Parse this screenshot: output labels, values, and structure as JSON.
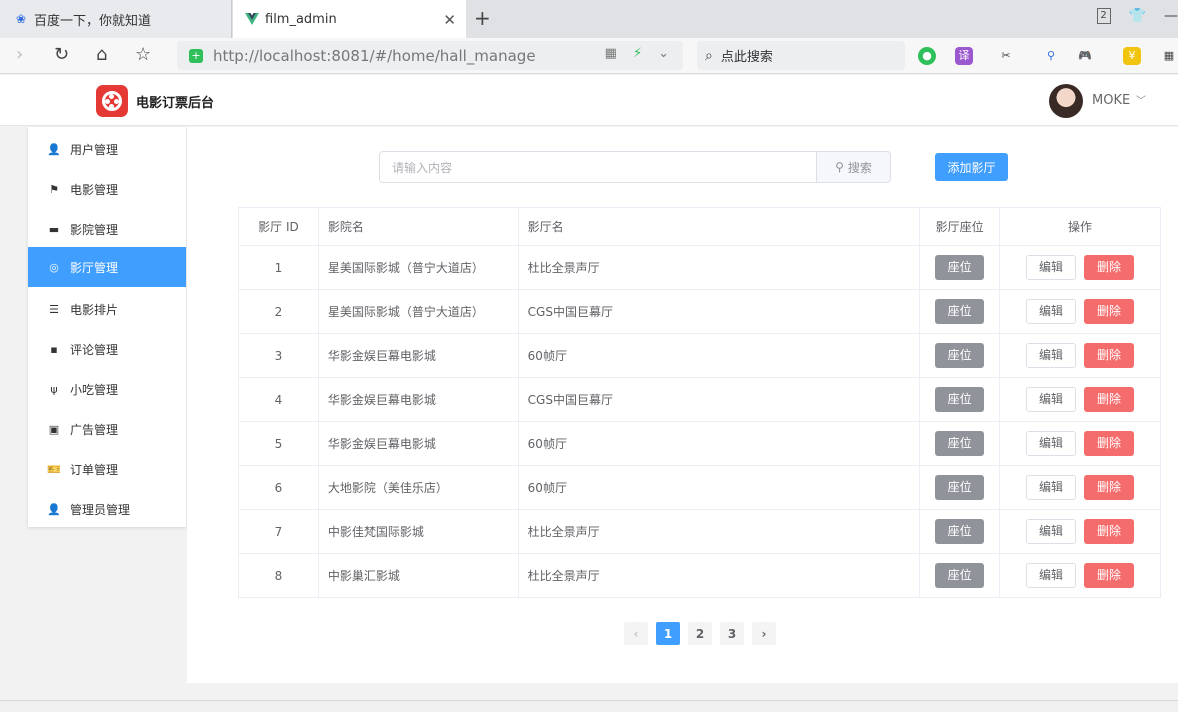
{
  "browser": {
    "tabs": [
      {
        "title": "百度一下，你就知道",
        "icon": "baidu-paw-icon"
      },
      {
        "title": "film_admin",
        "icon": "vue-logo-icon"
      }
    ],
    "url": "http://localhost:8081/#/home/hall_manage",
    "search_placeholder": "点此搜索",
    "window_badge": "2"
  },
  "app": {
    "brand": "电影订票后台",
    "username": "MOKE",
    "accent": "#409eff",
    "danger": "#f56c6c",
    "logo_color": "#e53935"
  },
  "sidebar": {
    "items": [
      {
        "label": "用户管理",
        "icon": "user-icon"
      },
      {
        "label": "电影管理",
        "icon": "flag-icon"
      },
      {
        "label": "影院管理",
        "icon": "cinema-icon"
      },
      {
        "label": "影厅管理",
        "icon": "hall-icon",
        "active": true
      },
      {
        "label": "电影排片",
        "icon": "list-icon"
      },
      {
        "label": "评论管理",
        "icon": "comment-icon"
      },
      {
        "label": "小吃管理",
        "icon": "fork-knife-icon"
      },
      {
        "label": "广告管理",
        "icon": "ad-icon"
      },
      {
        "label": "订单管理",
        "icon": "ticket-icon"
      },
      {
        "label": "管理员管理",
        "icon": "admin-icon"
      }
    ]
  },
  "toolbar": {
    "search_placeholder": "请输入内容",
    "search_button": "搜索",
    "add_button": "添加影厅"
  },
  "table": {
    "headers": [
      "影厅 ID",
      "影院名",
      "影厅名",
      "影厅座位",
      "操作"
    ],
    "seat_label": "座位",
    "edit_label": "编辑",
    "delete_label": "删除",
    "rows": [
      {
        "id": "1",
        "cinema": "星美国际影城（普宁大道店）",
        "hall": "杜比全景声厅"
      },
      {
        "id": "2",
        "cinema": "星美国际影城（普宁大道店）",
        "hall": "CGS中国巨幕厅"
      },
      {
        "id": "3",
        "cinema": "华影金娱巨幕电影城",
        "hall": "60帧厅"
      },
      {
        "id": "4",
        "cinema": "华影金娱巨幕电影城",
        "hall": "CGS中国巨幕厅"
      },
      {
        "id": "5",
        "cinema": "华影金娱巨幕电影城",
        "hall": "60帧厅"
      },
      {
        "id": "6",
        "cinema": "大地影院（美佳乐店）",
        "hall": "60帧厅"
      },
      {
        "id": "7",
        "cinema": "中影佳梵国际影城",
        "hall": "杜比全景声厅"
      },
      {
        "id": "8",
        "cinema": "中影巢汇影城",
        "hall": "杜比全景声厅"
      }
    ]
  },
  "pagination": {
    "prev": "‹",
    "next": "›",
    "pages": [
      "1",
      "2",
      "3"
    ],
    "current": "1"
  }
}
